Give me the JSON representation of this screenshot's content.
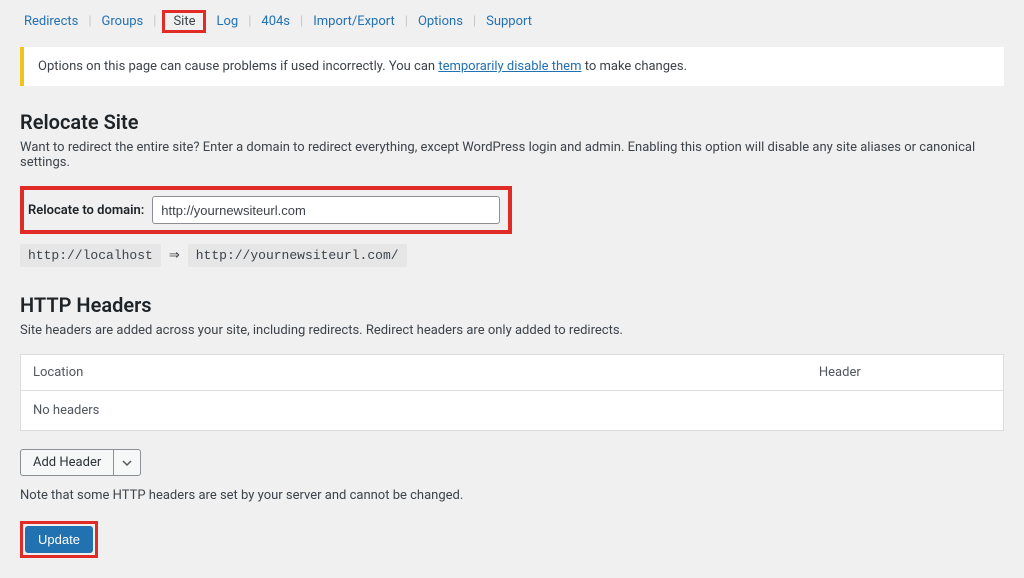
{
  "tabs": {
    "redirects": "Redirects",
    "groups": "Groups",
    "site": "Site",
    "log": "Log",
    "p404s": "404s",
    "import_export": "Import/Export",
    "options": "Options",
    "support": "Support"
  },
  "notice": {
    "prefix": "Options on this page can cause problems if used incorrectly. You can ",
    "link": "temporarily disable them",
    "suffix": " to make changes."
  },
  "relocate": {
    "heading": "Relocate Site",
    "description": "Want to redirect the entire site? Enter a domain to redirect everything, except WordPress login and admin. Enabling this option will disable any site aliases or canonical settings.",
    "label": "Relocate to domain:",
    "value": "http://yournewsiteurl.com",
    "from_code": "http://localhost",
    "arrow": "⇒",
    "to_code": "http://yournewsiteurl.com/"
  },
  "http_headers": {
    "heading": "HTTP Headers",
    "description": "Site headers are added across your site, including redirects. Redirect headers are only added to redirects.",
    "col_location": "Location",
    "col_header": "Header",
    "empty_row": "No headers",
    "add_button": "Add Header",
    "note": "Note that some HTTP headers are set by your server and cannot be changed."
  },
  "actions": {
    "update": "Update"
  }
}
